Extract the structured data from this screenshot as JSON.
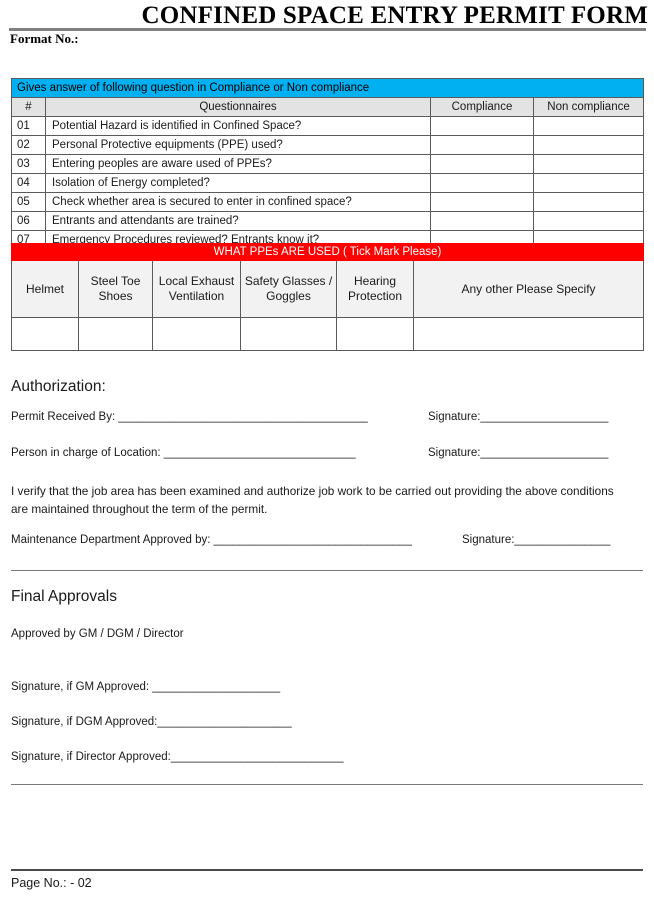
{
  "header": {
    "title": "CONFINED SPACE ENTRY PERMIT FORM",
    "format_no_label": "Format No.:"
  },
  "questionnaire": {
    "banner": "Gives answer of following question in Compliance or Non compliance",
    "columns": {
      "num": "#",
      "question": "Questionnaires",
      "compliance": "Compliance",
      "non_compliance": "Non compliance"
    },
    "rows": [
      {
        "num": "01",
        "question": "Potential Hazard is identified in Confined Space?",
        "compliance": "",
        "non_compliance": ""
      },
      {
        "num": "02",
        "question": "Personal Protective equipments (PPE) used?",
        "compliance": "",
        "non_compliance": ""
      },
      {
        "num": "03",
        "question": "Entering peoples are aware used of PPEs?",
        "compliance": "",
        "non_compliance": ""
      },
      {
        "num": "04",
        "question": "Isolation of Energy completed?",
        "compliance": "",
        "non_compliance": ""
      },
      {
        "num": "05",
        "question": "Check whether area is secured to enter in confined space?",
        "compliance": "",
        "non_compliance": ""
      },
      {
        "num": "06",
        "question": "Entrants and attendants are trained?",
        "compliance": "",
        "non_compliance": ""
      },
      {
        "num": "07",
        "question": "Emergency Procedures reviewed? Entrants know it?",
        "compliance": "",
        "non_compliance": ""
      }
    ]
  },
  "ppe": {
    "banner": "WHAT PPEs ARE USED ( Tick Mark Please)",
    "columns": [
      "Helmet",
      "Steel Toe Shoes",
      "Local Exhaust Ventilation",
      "Safety Glasses / Goggles",
      "Hearing Protection",
      "Any other Please Specify"
    ],
    "tick_values": [
      "",
      "",
      "",
      "",
      "",
      ""
    ]
  },
  "authorization": {
    "heading": "Authorization:",
    "permit_received_by": "Permit Received By: _______________________________________",
    "permit_received_signature": "Signature:____________________",
    "person_in_charge": "Person in charge of Location: ______________________________",
    "person_in_charge_signature": "Signature:____________________",
    "verification": "I verify that the job area has been examined and authorize job work to be carried out providing the above conditions are maintained throughout the term of the permit.",
    "maintenance_approved_by": "Maintenance Department Approved by: _______________________________",
    "maintenance_signature": "Signature:_______________"
  },
  "final_approvals": {
    "heading": "Final Approvals",
    "approved_by": "Approved by GM / DGM / Director",
    "signature_gm": "Signature, if GM Approved: ____________________",
    "signature_dgm": "Signature, if DGM Approved:_____________________",
    "signature_director": "Signature, if Director Approved:___________________________"
  },
  "footer": {
    "page_no": "Page No.: - 02"
  },
  "colors": {
    "banner_cyan": "#00B0F0",
    "banner_red": "#FF0000",
    "header_gray": "#e3e3e3",
    "ppe_head_gray": "#f2f2f2",
    "border_gray": "#5a5a5a",
    "rule_gray": "#808080"
  }
}
